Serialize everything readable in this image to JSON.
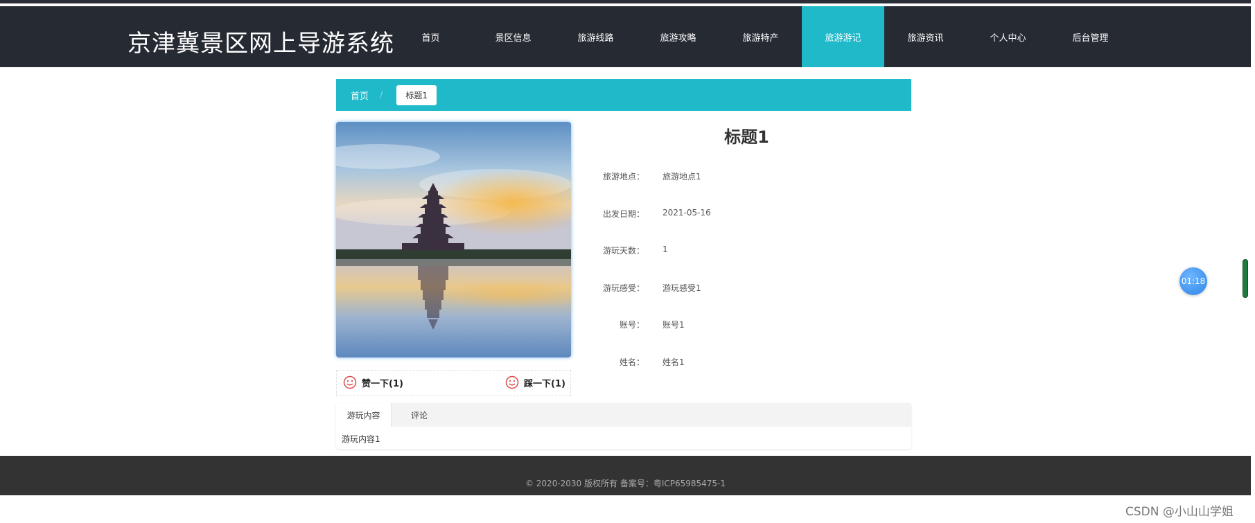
{
  "header": {
    "site_title": "京津冀景区网上导游系统",
    "nav": [
      {
        "label": "首页",
        "active": false
      },
      {
        "label": "景区信息",
        "active": false
      },
      {
        "label": "旅游线路",
        "active": false
      },
      {
        "label": "旅游攻略",
        "active": false
      },
      {
        "label": "旅游特产",
        "active": false
      },
      {
        "label": "旅游游记",
        "active": true
      },
      {
        "label": "旅游资讯",
        "active": false
      },
      {
        "label": "个人中心",
        "active": false
      },
      {
        "label": "后台管理",
        "active": false
      }
    ]
  },
  "breadcrumb": {
    "home": "首页",
    "separator": "/",
    "current": "标题1"
  },
  "detail": {
    "title": "标题1",
    "fields": [
      {
        "label": "旅游地点：",
        "value": "旅游地点1"
      },
      {
        "label": "出发日期：",
        "value": "2021-05-16"
      },
      {
        "label": "游玩天数：",
        "value": "1"
      },
      {
        "label": "游玩感受：",
        "value": "游玩感受1"
      },
      {
        "label": "账号：",
        "value": "账号1"
      },
      {
        "label": "姓名：",
        "value": "姓名1"
      }
    ]
  },
  "votes": {
    "like_label": "赞一下(1)",
    "dislike_label": "踩一下(1)",
    "icon": "smiley-face-icon"
  },
  "tabs": {
    "items": [
      {
        "label": "游玩内容",
        "active": true
      },
      {
        "label": "评论",
        "active": false
      }
    ],
    "content": "游玩内容1"
  },
  "footer": {
    "text": "© 2020-2030 版权所有 备案号：粤ICP65985475-1"
  },
  "overlay": {
    "timer": "01:18",
    "watermark": "CSDN @小山山学姐"
  },
  "colors": {
    "header_bg": "#262a33",
    "accent": "#1fb9c9",
    "footer_bg": "#333333"
  }
}
